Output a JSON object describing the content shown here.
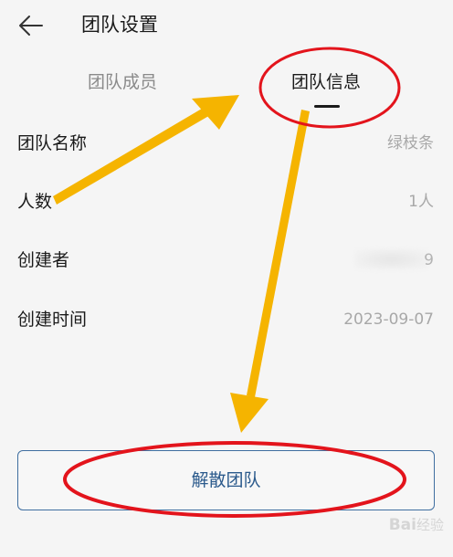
{
  "header": {
    "title": "团队设置",
    "back_icon": "arrow-left-icon"
  },
  "tabs": [
    {
      "label": "团队成员",
      "active": false
    },
    {
      "label": "团队信息",
      "active": true
    }
  ],
  "info_rows": [
    {
      "label": "团队名称",
      "value": "绿枝条"
    },
    {
      "label": "人数",
      "value": "1人"
    },
    {
      "label": "创建者",
      "value_visible_tail": "9",
      "value_blurred": true
    },
    {
      "label": "创建时间",
      "value": "2023-09-07"
    }
  ],
  "actions": {
    "dissolve_label": "解散团队"
  },
  "watermark": {
    "text": "Bai",
    "suffix": "经验"
  },
  "colors": {
    "background": "#f5f5f5",
    "button_border": "#3f6ea0",
    "button_text": "#2b5a8c",
    "annotation_red": "#e3141c",
    "annotation_arrow": "#f5b400",
    "muted_text": "#a8a8a8"
  }
}
